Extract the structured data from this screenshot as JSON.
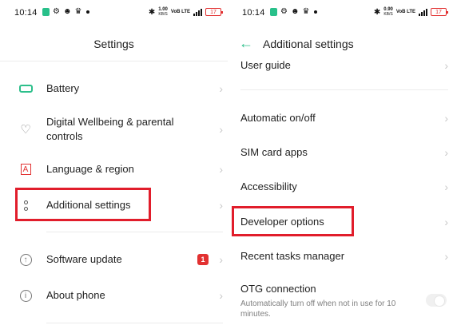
{
  "status": {
    "time": "10:14",
    "left_speed_value": "1.00",
    "left_speed_unit": "KB/S",
    "right_speed_value": "0.90",
    "right_speed_unit": "KB/S",
    "net_label": "VoB LTE",
    "battery": "17"
  },
  "left": {
    "title": "Settings",
    "items": [
      {
        "label": "Battery"
      },
      {
        "label": "Digital Wellbeing & parental controls"
      },
      {
        "label": "Language & region"
      },
      {
        "label": "Additional settings"
      },
      {
        "label": "Software update",
        "badge": "1"
      },
      {
        "label": "About phone"
      }
    ]
  },
  "right": {
    "title": "Additional settings",
    "items": [
      {
        "label": "User guide"
      },
      {
        "label": "Automatic on/off"
      },
      {
        "label": "SIM card apps"
      },
      {
        "label": "Accessibility"
      },
      {
        "label": "Developer options"
      },
      {
        "label": "Recent tasks manager"
      },
      {
        "label": "OTG connection",
        "description": "Automatically turn off when not in use for 10 minutes."
      }
    ]
  },
  "icons": {
    "back": "back-arrow-icon",
    "chevron": "chevron-right-icon"
  },
  "colors": {
    "accent": "#2dbf8b",
    "highlight": "#e11d2b",
    "badge": "#e23131"
  }
}
